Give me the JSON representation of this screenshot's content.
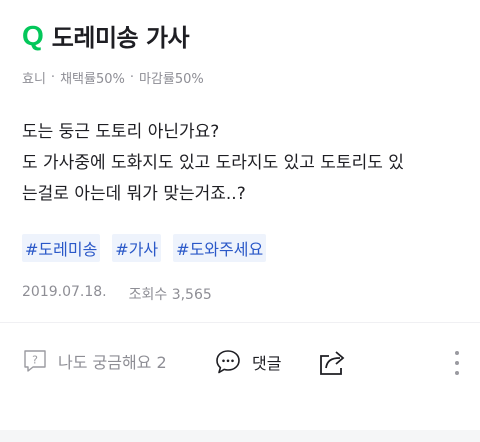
{
  "question": {
    "title": "도레미송 가사",
    "author": "효니",
    "adoption_rate": "채택률50%",
    "deadline_rate": "마감률50%",
    "body_lines": [
      "도는 둥근 도토리 아닌가요?",
      "도 가사중에 도화지도 있고 도라지도 있고 도토리도 있",
      "는걸로 아는데 뭐가 맞는거죠..?"
    ],
    "tags": [
      "#도레미송",
      "#가사",
      "#도와주세요"
    ],
    "date": "2019.07.18.",
    "views": "조회수 3,565"
  },
  "actions": {
    "curious_label": "나도 궁금해요 2",
    "comment_label": "댓글"
  },
  "colors": {
    "brand_green": "#03c75a",
    "tag_blue": "#2a58c8"
  },
  "icons": {
    "brand": "q-logo-icon",
    "curious": "question-box-icon",
    "comment": "speech-bubble-icon",
    "share": "share-icon",
    "more": "more-vertical-icon"
  }
}
